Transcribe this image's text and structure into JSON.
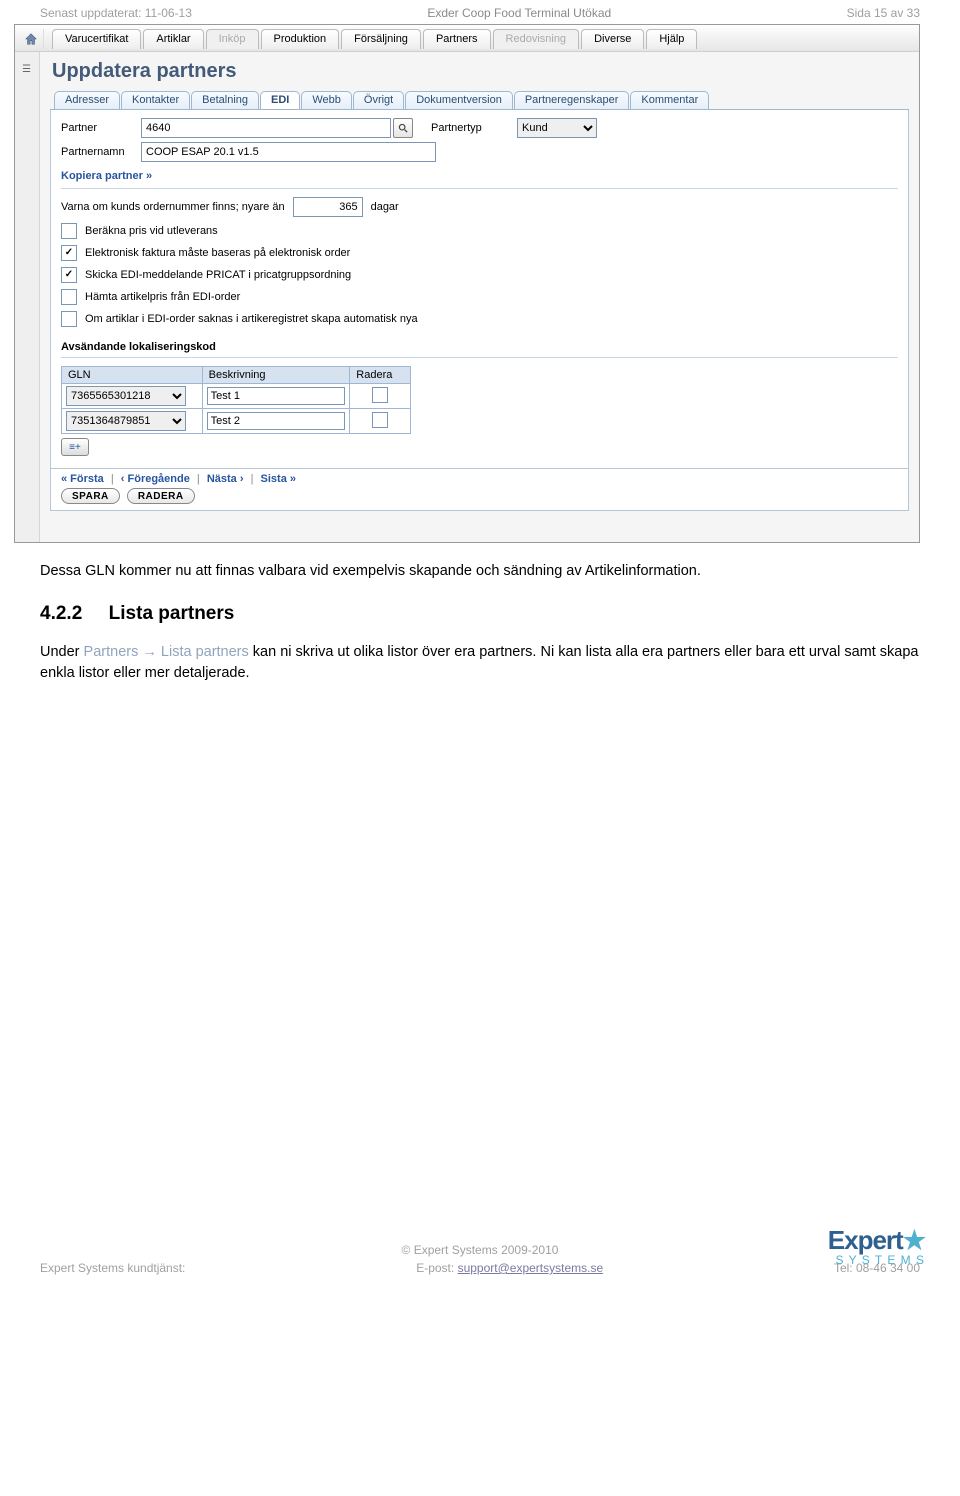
{
  "header": {
    "left": "Senast uppdaterat: 11-06-13",
    "center": "Exder Coop Food Terminal Utökad",
    "right": "Sida 15 av 33"
  },
  "menubar": {
    "items": [
      {
        "label": "Varucertifikat",
        "dim": false
      },
      {
        "label": "Artiklar",
        "dim": false
      },
      {
        "label": "Inköp",
        "dim": true
      },
      {
        "label": "Produktion",
        "dim": false
      },
      {
        "label": "Försäljning",
        "dim": false
      },
      {
        "label": "Partners",
        "dim": false
      },
      {
        "label": "Redovisning",
        "dim": true
      },
      {
        "label": "Diverse",
        "dim": false
      },
      {
        "label": "Hjälp",
        "dim": false
      }
    ]
  },
  "content": {
    "title": "Uppdatera partners",
    "tabs": [
      "Adresser",
      "Kontakter",
      "Betalning",
      "EDI",
      "Webb",
      "Övrigt",
      "Dokumentversion",
      "Partneregenskaper",
      "Kommentar"
    ],
    "active_tab": "EDI",
    "partner_label": "Partner",
    "partner_value": "4640",
    "partnertyp_label": "Partnertyp",
    "partnertyp_value": "Kund",
    "partnernamn_label": "Partnernamn",
    "partnernamn_value": "COOP ESAP 20.1 v1.5",
    "copy_link": "Kopiera partner »",
    "warn_pre": "Varna om kunds ordernummer finns; nyare än",
    "warn_value": "365",
    "warn_post": "dagar",
    "checks": [
      {
        "label": "Beräkna pris vid utleverans",
        "checked": false
      },
      {
        "label": "Elektronisk faktura måste baseras på elektronisk order",
        "checked": true
      },
      {
        "label": "Skicka EDI-meddelande PRICAT i pricatgruppsordning",
        "checked": true
      },
      {
        "label": "Hämta artikelpris från EDI-order",
        "checked": false
      },
      {
        "label": "Om artiklar i EDI-order saknas i artikeregistret skapa automatisk nya",
        "checked": false
      }
    ],
    "gln_heading": "Avsändande lokaliseringskod",
    "gln_headers": [
      "GLN",
      "Beskrivning",
      "Radera"
    ],
    "gln_rows": [
      {
        "gln": "7365565301218",
        "desc": "Test 1"
      },
      {
        "gln": "7351364879851",
        "desc": "Test 2"
      }
    ],
    "pager": {
      "first": "« Första",
      "prev": "‹ Föregående",
      "next": "Nästa ›",
      "last": "Sista »",
      "save": "SPARA",
      "delete": "RADERA"
    }
  },
  "body": {
    "p1": "Dessa GLN kommer nu att finnas valbara vid exempelvis skapande och sändning av Artikelinformation.",
    "heading_no": "4.2.2",
    "heading_text": "Lista partners",
    "p2_pre": "Under ",
    "p2_nav1": "Partners",
    "p2_arrow": " → ",
    "p2_nav2": "Lista partners",
    "p2_mid": " kan ni skriva ut olika listor över era partners. Ni kan lista alla era partners eller bara ett urval samt skapa enkla listor eller mer detaljerade."
  },
  "footer": {
    "copyright": "© Expert Systems 2009-2010",
    "left": "Expert Systems kundtjänst:",
    "mid_label": "E-post: ",
    "mid_link": "support@expertsystems.se",
    "right": "Tel: 08-46 34 00",
    "logo_main": "Expert",
    "logo_sub": "S Y S T E M S"
  }
}
